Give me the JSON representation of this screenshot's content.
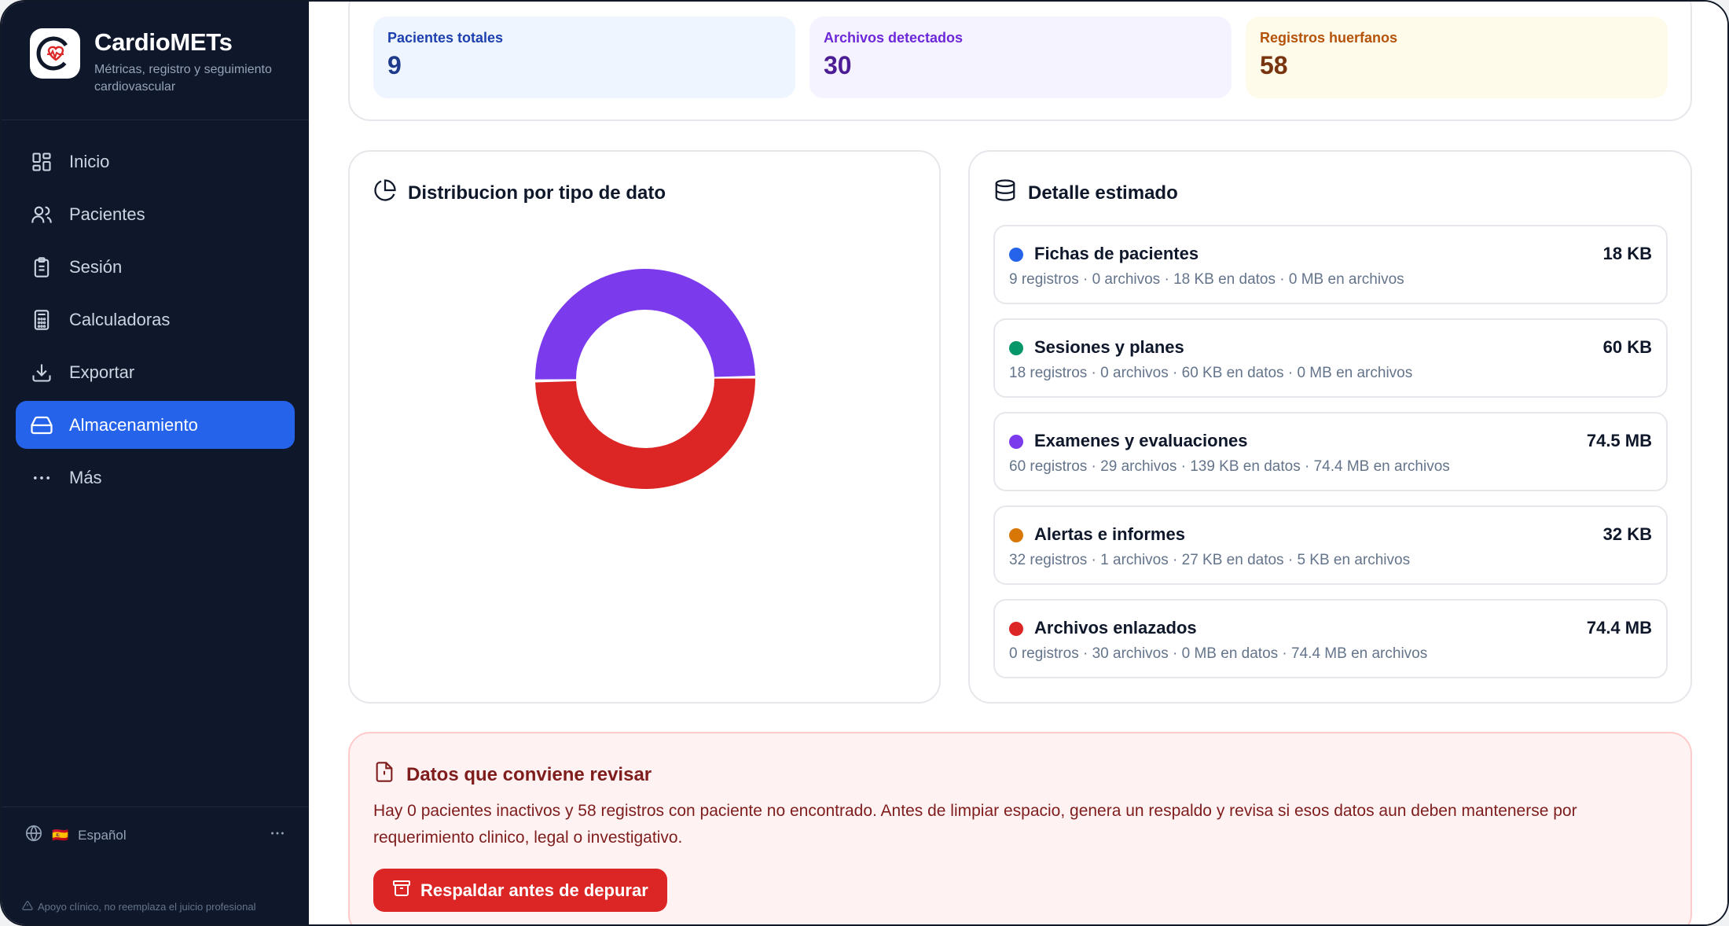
{
  "brand": {
    "title": "CardioMETs",
    "subtitle": "Métricas, registro y seguimiento cardiovascular"
  },
  "nav": [
    {
      "label": "Inicio",
      "icon": "grid-icon",
      "active": false
    },
    {
      "label": "Pacientes",
      "icon": "users-icon",
      "active": false
    },
    {
      "label": "Sesión",
      "icon": "clipboard-icon",
      "active": false
    },
    {
      "label": "Calculadoras",
      "icon": "calculator-icon",
      "active": false
    },
    {
      "label": "Exportar",
      "icon": "download-icon",
      "active": false
    },
    {
      "label": "Almacenamiento",
      "icon": "hard-drive-icon",
      "active": true
    },
    {
      "label": "Más",
      "icon": "more-horizontal-icon",
      "active": false
    }
  ],
  "language": {
    "flag": "🇪🇸",
    "label": "Español"
  },
  "disclaimer": "Apoyo clínico, no reemplaza el juicio profesional",
  "stats": [
    {
      "label": "Pacientes totales",
      "value": "9"
    },
    {
      "label": "Archivos detectados",
      "value": "30"
    },
    {
      "label": "Registros huerfanos",
      "value": "58"
    }
  ],
  "distribution": {
    "title": "Distribucion por tipo de dato"
  },
  "chart_data": {
    "type": "pie",
    "title": "Distribucion por tipo de dato",
    "categories": [
      "Fichas de pacientes",
      "Sesiones y planes",
      "Examenes y evaluaciones",
      "Alertas e informes",
      "Archivos enlazados"
    ],
    "values": [
      0.018,
      0.06,
      74.5,
      0.032,
      74.4
    ],
    "unit": "MB",
    "colors": [
      "#2563eb",
      "#059669",
      "#7c3aed",
      "#d97706",
      "#dc2626"
    ],
    "donut": true
  },
  "detail": {
    "title": "Detalle estimado",
    "items": [
      {
        "name": "Fichas de pacientes",
        "size": "18 KB",
        "meta": "9 registros · 0 archivos · 18 KB en datos · 0 MB en archivos",
        "color": "#2563eb"
      },
      {
        "name": "Sesiones y planes",
        "size": "60 KB",
        "meta": "18 registros · 0 archivos · 60 KB en datos · 0 MB en archivos",
        "color": "#059669"
      },
      {
        "name": "Examenes y evaluaciones",
        "size": "74.5 MB",
        "meta": "60 registros · 29 archivos · 139 KB en datos · 74.4 MB en archivos",
        "color": "#7c3aed"
      },
      {
        "name": "Alertas e informes",
        "size": "32 KB",
        "meta": "32 registros · 1 archivos · 27 KB en datos · 5 KB en archivos",
        "color": "#d97706"
      },
      {
        "name": "Archivos enlazados",
        "size": "74.4 MB",
        "meta": "0 registros · 30 archivos · 0 MB en datos · 74.4 MB en archivos",
        "color": "#dc2626"
      }
    ]
  },
  "review": {
    "title": "Datos que conviene revisar",
    "text": "Hay 0 pacientes inactivos y 58 registros con paciente no encontrado. Antes de limpiar espacio, genera un respaldo y revisa si esos datos aun deben mantenerse por requerimiento clinico, legal o investigativo.",
    "button": "Respaldar antes de depurar"
  }
}
